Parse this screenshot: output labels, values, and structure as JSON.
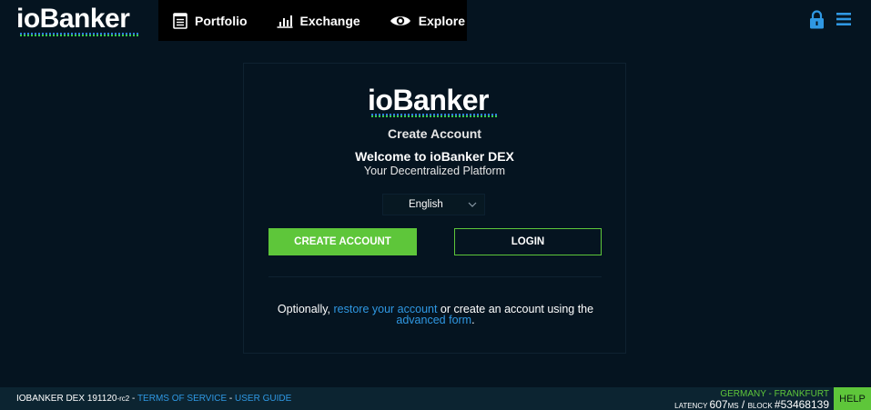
{
  "header": {
    "logo_text": "ioBanker",
    "nav": [
      {
        "label": "Portfolio",
        "icon": "document-icon"
      },
      {
        "label": "Exchange",
        "icon": "bar-chart-icon"
      },
      {
        "label": "Explore",
        "icon": "eye-icon"
      }
    ],
    "lock_icon": "lock-icon",
    "menu_icon": "hamburger-menu-icon"
  },
  "card": {
    "logo_text": "ioBanker",
    "title": "Create Account",
    "welcome": "Welcome to ioBanker DEX",
    "subtitle": "Your Decentralized Platform",
    "language": "English",
    "create_button": "CREATE ACCOUNT",
    "login_button": "LOGIN",
    "optional_prefix": "Optionally, ",
    "restore_link": "restore your account",
    "optional_middle": " or create an account using the ",
    "advanced_link": "advanced form",
    "optional_suffix": "."
  },
  "footer": {
    "version_prefix": "IOBANKER DEX ",
    "version_number": "191120",
    "version_suffix": "-rc2",
    "separator": " - ",
    "terms_link": "TERMS OF SERVICE",
    "guide_link": "USER GUIDE",
    "region": "GERMANY - FRANKFURT",
    "latency_label": "LATENCY ",
    "latency_value": "607",
    "latency_unit": "MS",
    "latency_sep": " / ",
    "block_label": "BLOCK ",
    "block_value": "#53468139",
    "help": "HELP"
  },
  "colors": {
    "background": "#051420",
    "accent_green": "#5ec63a",
    "link_blue": "#2f98e3",
    "footer_bg": "#0c2431"
  }
}
